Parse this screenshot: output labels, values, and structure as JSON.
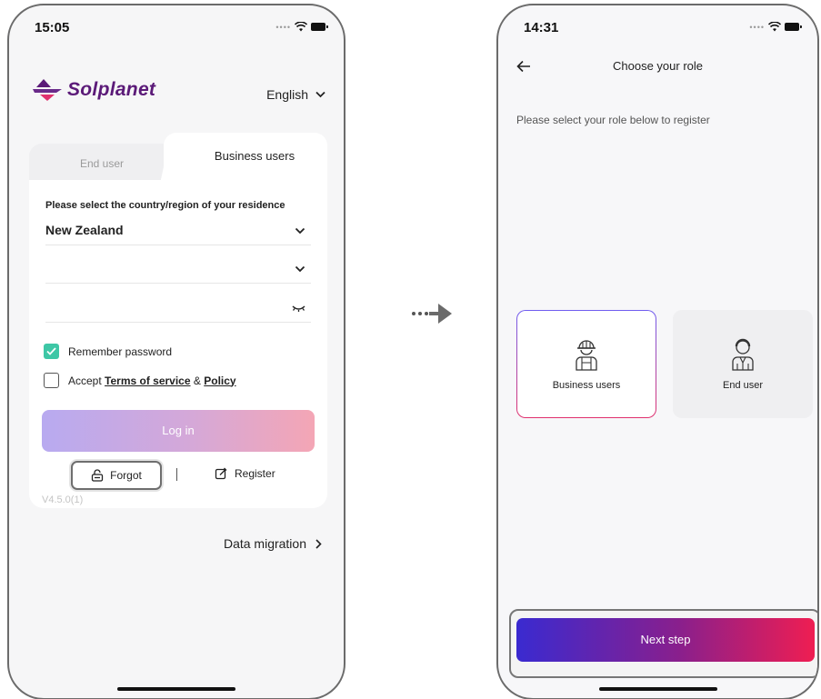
{
  "left_screen": {
    "status_time": "15:05",
    "brand_name": "Solplanet",
    "language": "English",
    "tabs": {
      "end_user": "End user",
      "business_users": "Business users"
    },
    "region_label": "Please select the country/region of your residence",
    "region_value": "New Zealand",
    "remember_password": "Remember password",
    "accept_prefix": "Accept",
    "terms_link": "Terms of service",
    "accept_and": "&",
    "policy_link": "Policy",
    "login_label": "Log in",
    "forgot_label": "Forgot",
    "separator": "|",
    "register_label": "Register",
    "version": "V4.5.0(1)",
    "data_migration": "Data migration",
    "remember_checked": true,
    "accept_checked": false
  },
  "right_screen": {
    "status_time": "14:31",
    "title": "Choose your role",
    "subtitle": "Please select your role below to register",
    "roles": [
      {
        "label": "Business users",
        "selected": true
      },
      {
        "label": "End user",
        "selected": false
      }
    ],
    "next_label": "Next step"
  },
  "colors": {
    "brand_purple": "#5b1a78",
    "check_green": "#3ec7a6",
    "next_gradient_start": "#3a2ad0",
    "next_gradient_end": "#ef1e52"
  }
}
